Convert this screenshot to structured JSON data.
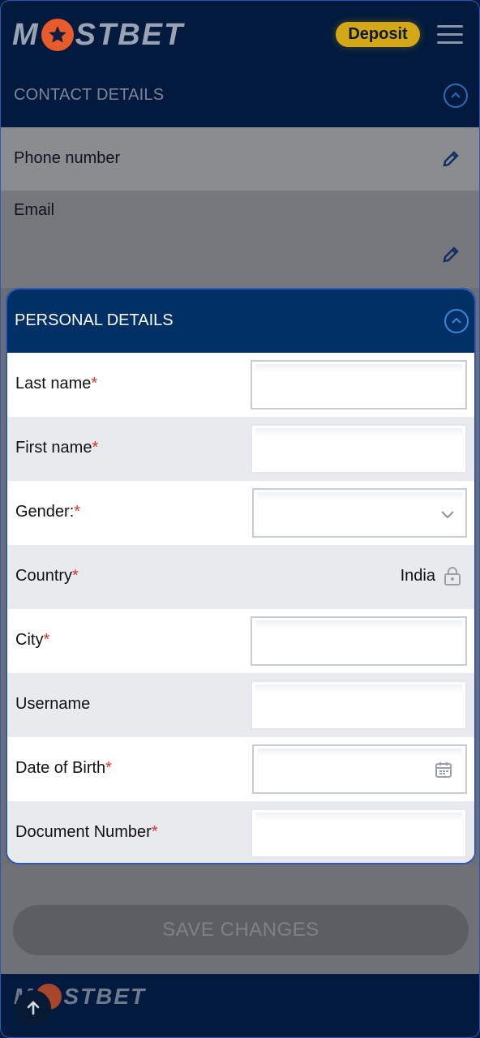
{
  "header": {
    "logo_left": "M",
    "logo_right": "STBET",
    "deposit_label": "Deposit"
  },
  "contact": {
    "title": "CONTACT DETAILS",
    "phone_label": "Phone number",
    "email_label": "Email"
  },
  "personal": {
    "title": "PERSONAL DETAILS",
    "rows": [
      {
        "label": "Last name",
        "required": "*"
      },
      {
        "label": "First name",
        "required": "*"
      },
      {
        "label": "Gender:",
        "required": "*"
      },
      {
        "label": "Country",
        "required": "*",
        "value": "India"
      },
      {
        "label": "City",
        "required": "*"
      },
      {
        "label": "Username",
        "required": ""
      },
      {
        "label": "Date of Birth",
        "required": "*"
      },
      {
        "label": "Document Number",
        "required": "*"
      }
    ]
  },
  "save_label": "SAVE CHANGES",
  "footer": {
    "logo_left": "M",
    "logo_right": "STBET"
  },
  "colors": {
    "navy": "#011a3d",
    "section_header": "#003066",
    "deposit": "#d3a716",
    "required": "#e0302a",
    "accent_chevron": "#2d6ab8"
  },
  "icons": [
    "star-icon",
    "menu-icon",
    "chevron-up-icon",
    "pencil-icon",
    "chevron-down-icon",
    "lock-icon",
    "calendar-icon",
    "arrow-up-icon"
  ]
}
